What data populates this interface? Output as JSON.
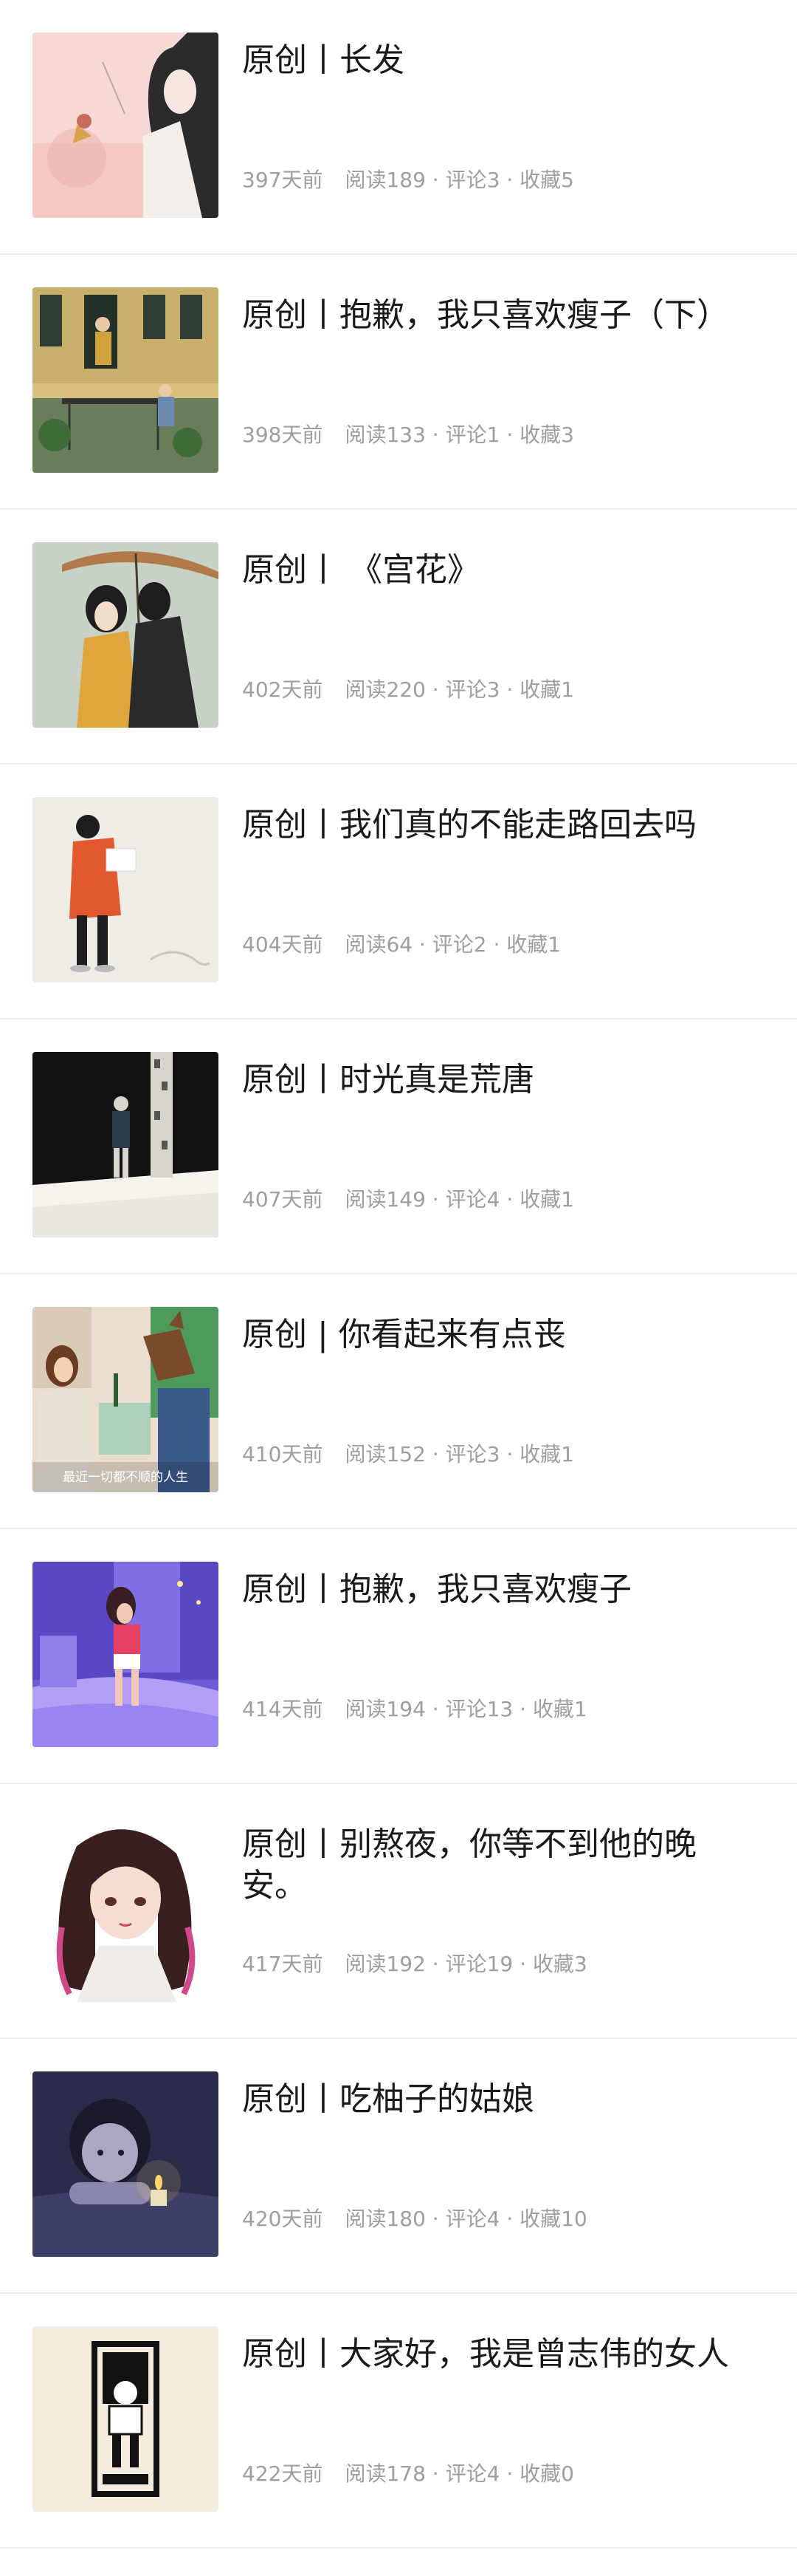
{
  "articles": [
    {
      "title": "原创丨长发",
      "days": "397天前",
      "stats": "阅读189 · 评论3 · 收藏5",
      "thumbnail": "girl-with-pigtails-and-bird-illustration"
    },
    {
      "title": "原创丨抱歉，我只喜欢瘦子（下）",
      "days": "398天前",
      "stats": "阅读133 · 评论1 · 收藏3",
      "thumbnail": "couple-on-balcony-illustration"
    },
    {
      "title": "原创丨 《宫花》",
      "days": "402天前",
      "stats": "阅读220 · 评论3 · 收藏1",
      "thumbnail": "couple-under-umbrella-illustration"
    },
    {
      "title": "原创丨我们真的不能走路回去吗",
      "days": "404天前",
      "stats": "阅读64 · 评论2 · 收藏1",
      "thumbnail": "person-in-orange-coat-illustration"
    },
    {
      "title": "原创丨时光真是荒唐",
      "days": "407天前",
      "stats": "阅读149 · 评论4 · 收藏1",
      "thumbnail": "figure-in-dark-room-illustration"
    },
    {
      "title": "原创 | 你看起来有点丧",
      "days": "410天前",
      "stats": "阅读152 · 评论3 · 收藏1",
      "thumbnail": "bojack-horseman-scene",
      "thumbnail_caption": "最近一切都不顺的人生"
    },
    {
      "title": "原创丨抱歉，我只喜欢瘦子",
      "days": "414天前",
      "stats": "阅读194 · 评论13 · 收藏1",
      "thumbnail": "girl-on-bed-purple-illustration"
    },
    {
      "title": "原创丨别熬夜，你等不到他的晚安。",
      "days": "417天前",
      "stats": "阅读192 · 评论19 · 收藏3",
      "thumbnail": "anime-girl-illustration"
    },
    {
      "title": "原创丨吃柚子的姑娘",
      "days": "420天前",
      "stats": "阅读180 · 评论4 · 收藏10",
      "thumbnail": "girl-with-candle-illustration"
    },
    {
      "title": "原创丨大家好，我是曾志伟的女人",
      "days": "422天前",
      "stats": "阅读178 · 评论4 · 收藏0",
      "thumbnail": "framed-figure-illustration"
    }
  ]
}
